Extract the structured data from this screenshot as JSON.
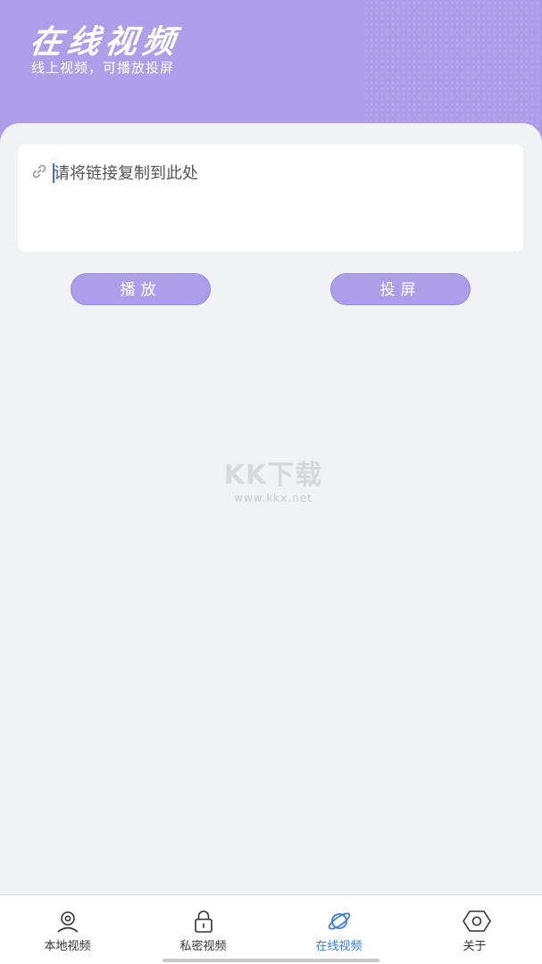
{
  "header": {
    "title": "在线视频",
    "subtitle": "线上视频，可播放投屏",
    "background_color": "#ad9eea"
  },
  "url_input": {
    "icon": "link-icon",
    "placeholder": "请将链接复制到此处",
    "value": ""
  },
  "actions": {
    "play_label": "播放",
    "cast_label": "投屏",
    "button_color": "#ad9eea"
  },
  "watermark": {
    "logo": "KK下载",
    "url": "www.kkx.net"
  },
  "tabbar": {
    "active_color": "#3b7de0",
    "items": [
      {
        "label": "本地视频",
        "icon": "user-icon",
        "active": false
      },
      {
        "label": "私密视频",
        "icon": "lock-icon",
        "active": false
      },
      {
        "label": "在线视频",
        "icon": "planet-icon",
        "active": true
      },
      {
        "label": "关于",
        "icon": "hexagon-eye-icon",
        "active": false
      }
    ]
  }
}
